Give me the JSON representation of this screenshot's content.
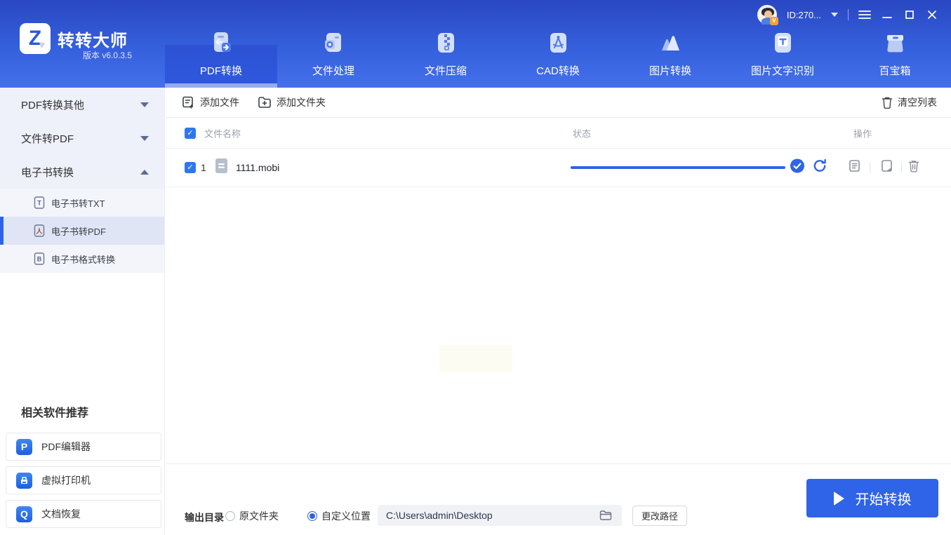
{
  "app": {
    "logo_letter": "Z",
    "title": "转转大师",
    "version": "版本 v6.0.3.5",
    "user_id": "ID:270...",
    "avatar_badge": "V"
  },
  "header": {
    "tabs": [
      {
        "label": "PDF转换",
        "icon": "pdf-convert-icon",
        "active": true
      },
      {
        "label": "文件处理",
        "icon": "file-process-icon",
        "active": false
      },
      {
        "label": "文件压缩",
        "icon": "file-compress-icon",
        "active": false
      },
      {
        "label": "CAD转换",
        "icon": "cad-convert-icon",
        "active": false
      },
      {
        "label": "图片转换",
        "icon": "image-convert-icon",
        "active": false
      },
      {
        "label": "图片文字识别",
        "icon": "ocr-icon",
        "active": false
      },
      {
        "label": "百宝箱",
        "icon": "toolbox-icon",
        "active": false
      }
    ]
  },
  "sidebar": {
    "groups": [
      {
        "label": "PDF转换其他",
        "state": "collapsed"
      },
      {
        "label": "文件转PDF",
        "state": "collapsed"
      },
      {
        "label": "电子书转换",
        "state": "expanded"
      }
    ],
    "subitems": [
      {
        "label": "电子书转TXT",
        "glyph": "T",
        "active": false
      },
      {
        "label": "电子书转PDF",
        "glyph": "人",
        "active": true
      },
      {
        "label": "电子书格式转换",
        "glyph": "B",
        "active": false
      }
    ],
    "promo": {
      "heading": "相关软件推荐",
      "items": [
        {
          "label": "PDF编辑器",
          "glyph": "P"
        },
        {
          "label": "虚拟打印机",
          "glyph": "⇥"
        },
        {
          "label": "文档恢复",
          "glyph": "Q"
        }
      ]
    }
  },
  "toolbar": {
    "add_file": "添加文件",
    "add_folder": "添加文件夹",
    "clear_list": "清空列表"
  },
  "table": {
    "columns": {
      "name": "文件名称",
      "status": "状态",
      "actions": "操作"
    },
    "rows": [
      {
        "index": "1",
        "filename": "1111.mobi",
        "progress_percent": 100,
        "status": "complete",
        "checked": true
      }
    ]
  },
  "footer": {
    "output_label": "输出目录",
    "radio_original": "原文件夹",
    "radio_custom": "自定义位置",
    "custom_selected": true,
    "path_value": "C:\\Users\\admin\\Desktop",
    "change_path": "更改路径",
    "start_button": "开始转换"
  },
  "colors": {
    "header_top": "#2a47c2",
    "header_bottom": "#4470ea",
    "accent_blue": "#2f63e8",
    "sidebar_bg": "#eef0fa",
    "active_tab": "#2e58dd"
  }
}
